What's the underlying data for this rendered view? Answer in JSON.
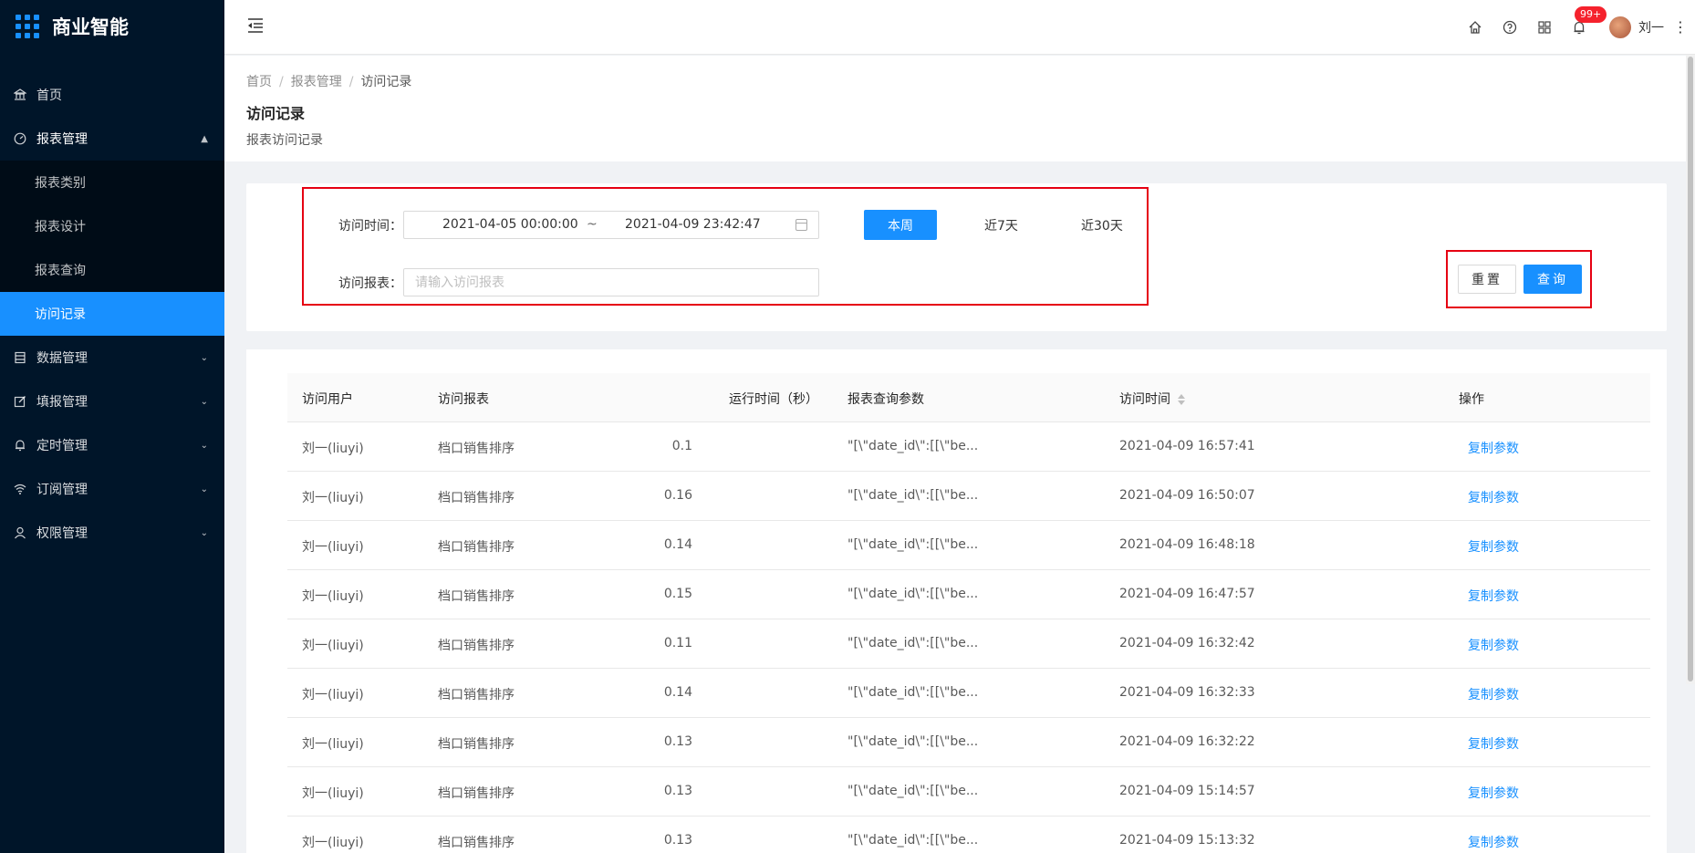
{
  "app": {
    "title": "商业智能"
  },
  "sidebar": {
    "items": [
      {
        "label": "首页",
        "icon": "bank-icon"
      },
      {
        "label": "报表管理",
        "icon": "dashboard-icon",
        "expanded": true,
        "children": [
          {
            "label": "报表类别"
          },
          {
            "label": "报表设计"
          },
          {
            "label": "报表查询"
          },
          {
            "label": "访问记录",
            "active": true
          }
        ]
      },
      {
        "label": "数据管理",
        "icon": "database-icon"
      },
      {
        "label": "填报管理",
        "icon": "edit-icon"
      },
      {
        "label": "定时管理",
        "icon": "bell-icon"
      },
      {
        "label": "订阅管理",
        "icon": "wifi-icon"
      },
      {
        "label": "权限管理",
        "icon": "user-icon"
      }
    ]
  },
  "header": {
    "notification_count": "99+",
    "username": "刘一"
  },
  "breadcrumb": [
    "首页",
    "报表管理",
    "访问记录"
  ],
  "page": {
    "title": "访问记录",
    "subtitle": "报表访问记录"
  },
  "search": {
    "time_label": "访问时间：",
    "start": "2021-04-05 00:00:00",
    "tilde": "~",
    "end": "2021-04-09 23:42:47",
    "this_week": "本周",
    "last7": "近7天",
    "last30": "近30天",
    "report_label": "访问报表：",
    "report_placeholder": "请输入访问报表",
    "reset": "重置",
    "query": "查询"
  },
  "table": {
    "columns": [
      "访问用户",
      "访问报表",
      "运行时间（秒）",
      "报表查询参数",
      "访问时间",
      "操作"
    ],
    "rows": [
      {
        "user": "刘一(liuyi)",
        "report": "档口销售排序",
        "runtime": "0.1",
        "param": "\"[\\\"date_id\\\":[[\\\"be...",
        "time": "2021-04-09 16:57:41",
        "op": "复制参数"
      },
      {
        "user": "刘一(liuyi)",
        "report": "档口销售排序",
        "runtime": "0.16",
        "param": "\"[\\\"date_id\\\":[[\\\"be...",
        "time": "2021-04-09 16:50:07",
        "op": "复制参数"
      },
      {
        "user": "刘一(liuyi)",
        "report": "档口销售排序",
        "runtime": "0.14",
        "param": "\"[\\\"date_id\\\":[[\\\"be...",
        "time": "2021-04-09 16:48:18",
        "op": "复制参数"
      },
      {
        "user": "刘一(liuyi)",
        "report": "档口销售排序",
        "runtime": "0.15",
        "param": "\"[\\\"date_id\\\":[[\\\"be...",
        "time": "2021-04-09 16:47:57",
        "op": "复制参数"
      },
      {
        "user": "刘一(liuyi)",
        "report": "档口销售排序",
        "runtime": "0.11",
        "param": "\"[\\\"date_id\\\":[[\\\"be...",
        "time": "2021-04-09 16:32:42",
        "op": "复制参数"
      },
      {
        "user": "刘一(liuyi)",
        "report": "档口销售排序",
        "runtime": "0.14",
        "param": "\"[\\\"date_id\\\":[[\\\"be...",
        "time": "2021-04-09 16:32:33",
        "op": "复制参数"
      },
      {
        "user": "刘一(liuyi)",
        "report": "档口销售排序",
        "runtime": "0.13",
        "param": "\"[\\\"date_id\\\":[[\\\"be...",
        "time": "2021-04-09 16:32:22",
        "op": "复制参数"
      },
      {
        "user": "刘一(liuyi)",
        "report": "档口销售排序",
        "runtime": "0.13",
        "param": "\"[\\\"date_id\\\":[[\\\"be...",
        "time": "2021-04-09 15:14:57",
        "op": "复制参数"
      },
      {
        "user": "刘一(liuyi)",
        "report": "档口销售排序",
        "runtime": "0.13",
        "param": "\"[\\\"date_id\\\":[[\\\"be...",
        "time": "2021-04-09 15:13:32",
        "op": "复制参数"
      }
    ]
  },
  "colors": {
    "primary": "#1890ff",
    "sidebar_bg": "#001529",
    "highlight": "#e60012"
  }
}
